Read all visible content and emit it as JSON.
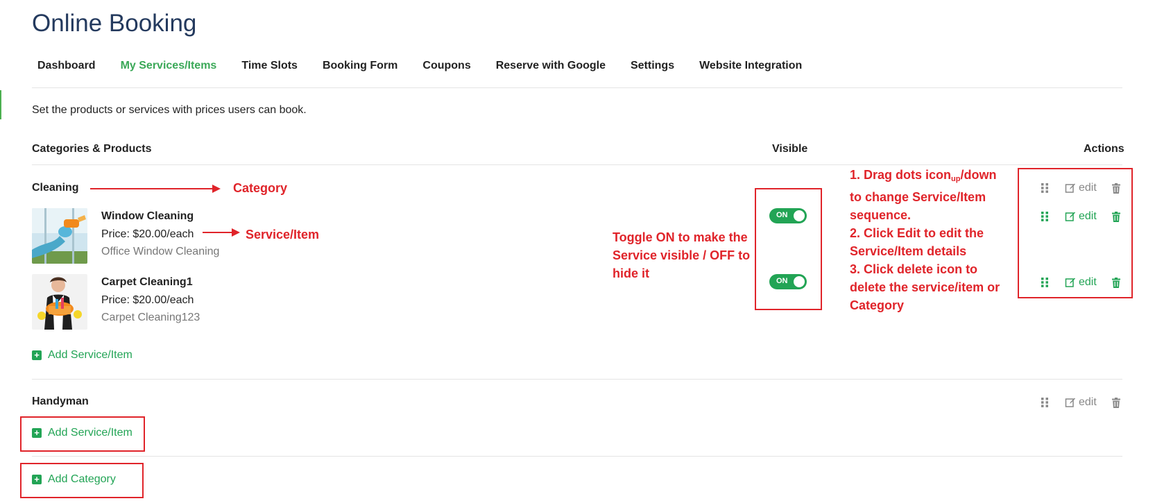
{
  "page": {
    "title": "Online Booking",
    "description": "Set the products or services with prices users can book."
  },
  "tabs": [
    {
      "label": "Dashboard"
    },
    {
      "label": "My Services/Items"
    },
    {
      "label": "Time Slots"
    },
    {
      "label": "Booking Form"
    },
    {
      "label": "Coupons"
    },
    {
      "label": "Reserve with Google"
    },
    {
      "label": "Settings"
    },
    {
      "label": "Website Integration"
    }
  ],
  "active_tab": "My Services/Items",
  "columns": {
    "categories": "Categories & Products",
    "visible": "Visible",
    "actions": "Actions"
  },
  "categories": [
    {
      "name": "Cleaning",
      "items": [
        {
          "name": "Window Cleaning",
          "price": "Price: $20.00/each",
          "description": "Office Window Cleaning",
          "visible_label": "ON"
        },
        {
          "name": "Carpet Cleaning1",
          "price": "Price: $20.00/each",
          "description": "Carpet Cleaning123",
          "visible_label": "ON"
        }
      ],
      "add_item_label": "Add Service/Item"
    },
    {
      "name": "Handyman",
      "items": [],
      "add_item_label": "Add Service/Item"
    }
  ],
  "add_category_label": "Add Category",
  "edit_label": "edit",
  "annotations": {
    "category": "Category",
    "service_item": "Service/Item",
    "toggle_lines": [
      "Toggle ON to make the",
      "Service visible / OFF to",
      "hide it"
    ],
    "actions_lines": [
      "1. Drag dots icon",
      "up",
      "/down",
      "to change Service/Item",
      "sequence.",
      "2. Click Edit to edit the",
      "Service/Item details",
      "3. Click delete icon to",
      "delete the service/item or",
      "Category"
    ]
  },
  "colors": {
    "accent_green": "#22a455",
    "active_tab": "#3aa857",
    "title_navy": "#243a5e",
    "annotation_red": "#e0242a",
    "muted_grey": "#888888"
  },
  "icons": [
    "drag-dots-icon",
    "edit-icon",
    "trash-icon",
    "plus-square-icon"
  ]
}
